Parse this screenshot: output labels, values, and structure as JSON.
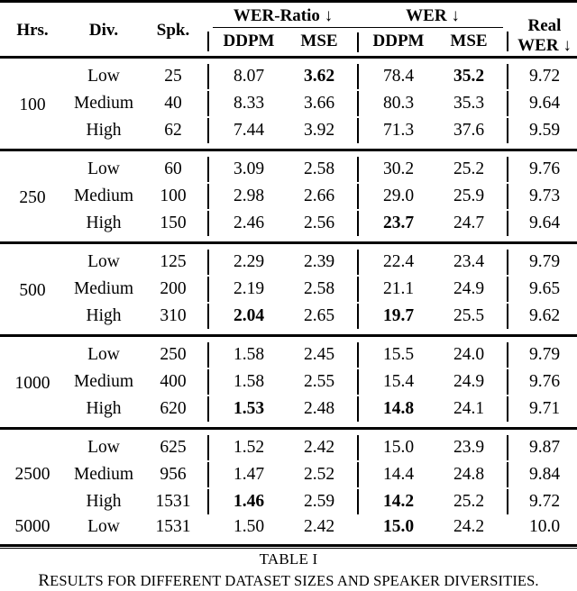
{
  "table": {
    "header": {
      "hrs": "Hrs.",
      "div": "Div.",
      "spk": "Spk.",
      "group_wer_ratio": "WER-Ratio ↓",
      "group_wer": "WER ↓",
      "sub_ddpm_ratio": "DDPM",
      "sub_mse_ratio": "MSE",
      "sub_ddpm_wer": "DDPM",
      "sub_mse_wer": "MSE",
      "real_line1": "Real",
      "real_line2": "WER ↓"
    },
    "groups": [
      {
        "hrs": "100",
        "rows": [
          {
            "div": "Low",
            "spk": "25",
            "ratio_ddpm": "8.07",
            "ratio_ddpm_bold": false,
            "ratio_mse": "3.62",
            "ratio_mse_bold": true,
            "wer_ddpm": "78.4",
            "wer_ddpm_bold": false,
            "wer_mse": "35.2",
            "wer_mse_bold": true,
            "real_wer": "9.72"
          },
          {
            "div": "Medium",
            "spk": "40",
            "ratio_ddpm": "8.33",
            "ratio_ddpm_bold": false,
            "ratio_mse": "3.66",
            "ratio_mse_bold": false,
            "wer_ddpm": "80.3",
            "wer_ddpm_bold": false,
            "wer_mse": "35.3",
            "wer_mse_bold": false,
            "real_wer": "9.64"
          },
          {
            "div": "High",
            "spk": "62",
            "ratio_ddpm": "7.44",
            "ratio_ddpm_bold": false,
            "ratio_mse": "3.92",
            "ratio_mse_bold": false,
            "wer_ddpm": "71.3",
            "wer_ddpm_bold": false,
            "wer_mse": "37.6",
            "wer_mse_bold": false,
            "real_wer": "9.59"
          }
        ]
      },
      {
        "hrs": "250",
        "rows": [
          {
            "div": "Low",
            "spk": "60",
            "ratio_ddpm": "3.09",
            "ratio_ddpm_bold": false,
            "ratio_mse": "2.58",
            "ratio_mse_bold": false,
            "wer_ddpm": "30.2",
            "wer_ddpm_bold": false,
            "wer_mse": "25.2",
            "wer_mse_bold": false,
            "real_wer": "9.76"
          },
          {
            "div": "Medium",
            "spk": "100",
            "ratio_ddpm": "2.98",
            "ratio_ddpm_bold": false,
            "ratio_mse": "2.66",
            "ratio_mse_bold": false,
            "wer_ddpm": "29.0",
            "wer_ddpm_bold": false,
            "wer_mse": "25.9",
            "wer_mse_bold": false,
            "real_wer": "9.73"
          },
          {
            "div": "High",
            "spk": "150",
            "ratio_ddpm": "2.46",
            "ratio_ddpm_bold": false,
            "ratio_mse": "2.56",
            "ratio_mse_bold": false,
            "wer_ddpm": "23.7",
            "wer_ddpm_bold": true,
            "wer_mse": "24.7",
            "wer_mse_bold": false,
            "real_wer": "9.64"
          }
        ]
      },
      {
        "hrs": "500",
        "rows": [
          {
            "div": "Low",
            "spk": "125",
            "ratio_ddpm": "2.29",
            "ratio_ddpm_bold": false,
            "ratio_mse": "2.39",
            "ratio_mse_bold": false,
            "wer_ddpm": "22.4",
            "wer_ddpm_bold": false,
            "wer_mse": "23.4",
            "wer_mse_bold": false,
            "real_wer": "9.79"
          },
          {
            "div": "Medium",
            "spk": "200",
            "ratio_ddpm": "2.19",
            "ratio_ddpm_bold": false,
            "ratio_mse": "2.58",
            "ratio_mse_bold": false,
            "wer_ddpm": "21.1",
            "wer_ddpm_bold": false,
            "wer_mse": "24.9",
            "wer_mse_bold": false,
            "real_wer": "9.65"
          },
          {
            "div": "High",
            "spk": "310",
            "ratio_ddpm": "2.04",
            "ratio_ddpm_bold": true,
            "ratio_mse": "2.65",
            "ratio_mse_bold": false,
            "wer_ddpm": "19.7",
            "wer_ddpm_bold": true,
            "wer_mse": "25.5",
            "wer_mse_bold": false,
            "real_wer": "9.62"
          }
        ]
      },
      {
        "hrs": "1000",
        "rows": [
          {
            "div": "Low",
            "spk": "250",
            "ratio_ddpm": "1.58",
            "ratio_ddpm_bold": false,
            "ratio_mse": "2.45",
            "ratio_mse_bold": false,
            "wer_ddpm": "15.5",
            "wer_ddpm_bold": false,
            "wer_mse": "24.0",
            "wer_mse_bold": false,
            "real_wer": "9.79"
          },
          {
            "div": "Medium",
            "spk": "400",
            "ratio_ddpm": "1.58",
            "ratio_ddpm_bold": false,
            "ratio_mse": "2.55",
            "ratio_mse_bold": false,
            "wer_ddpm": "15.4",
            "wer_ddpm_bold": false,
            "wer_mse": "24.9",
            "wer_mse_bold": false,
            "real_wer": "9.76"
          },
          {
            "div": "High",
            "spk": "620",
            "ratio_ddpm": "1.53",
            "ratio_ddpm_bold": true,
            "ratio_mse": "2.48",
            "ratio_mse_bold": false,
            "wer_ddpm": "14.8",
            "wer_ddpm_bold": true,
            "wer_mse": "24.1",
            "wer_mse_bold": false,
            "real_wer": "9.71"
          }
        ]
      },
      {
        "hrs": "2500",
        "hrs2": "5000",
        "rows": [
          {
            "div": "Low",
            "spk": "625",
            "ratio_ddpm": "1.52",
            "ratio_ddpm_bold": false,
            "ratio_mse": "2.42",
            "ratio_mse_bold": false,
            "wer_ddpm": "15.0",
            "wer_ddpm_bold": false,
            "wer_mse": "23.9",
            "wer_mse_bold": false,
            "real_wer": "9.87"
          },
          {
            "div": "Medium",
            "spk": "956",
            "ratio_ddpm": "1.47",
            "ratio_ddpm_bold": false,
            "ratio_mse": "2.52",
            "ratio_mse_bold": false,
            "wer_ddpm": "14.4",
            "wer_ddpm_bold": false,
            "wer_mse": "24.8",
            "wer_mse_bold": false,
            "real_wer": "9.84"
          },
          {
            "div": "High",
            "spk": "1531",
            "ratio_ddpm": "1.46",
            "ratio_ddpm_bold": true,
            "ratio_mse": "2.59",
            "ratio_mse_bold": false,
            "wer_ddpm": "14.2",
            "wer_ddpm_bold": true,
            "wer_mse": "25.2",
            "wer_mse_bold": false,
            "real_wer": "9.72"
          },
          {
            "div": "Low",
            "spk": "1531",
            "ratio_ddpm": "1.50",
            "ratio_ddpm_bold": false,
            "ratio_mse": "2.42",
            "ratio_mse_bold": false,
            "wer_ddpm": "15.0",
            "wer_ddpm_bold": true,
            "wer_mse": "24.2",
            "wer_mse_bold": false,
            "real_wer": "10.0"
          }
        ]
      }
    ]
  },
  "caption": {
    "title": "TABLE I",
    "subtitle_first": "R",
    "subtitle_rest": "ESULTS FOR DIFFERENT DATASET SIZES AND SPEAKER DIVERSITIES."
  }
}
